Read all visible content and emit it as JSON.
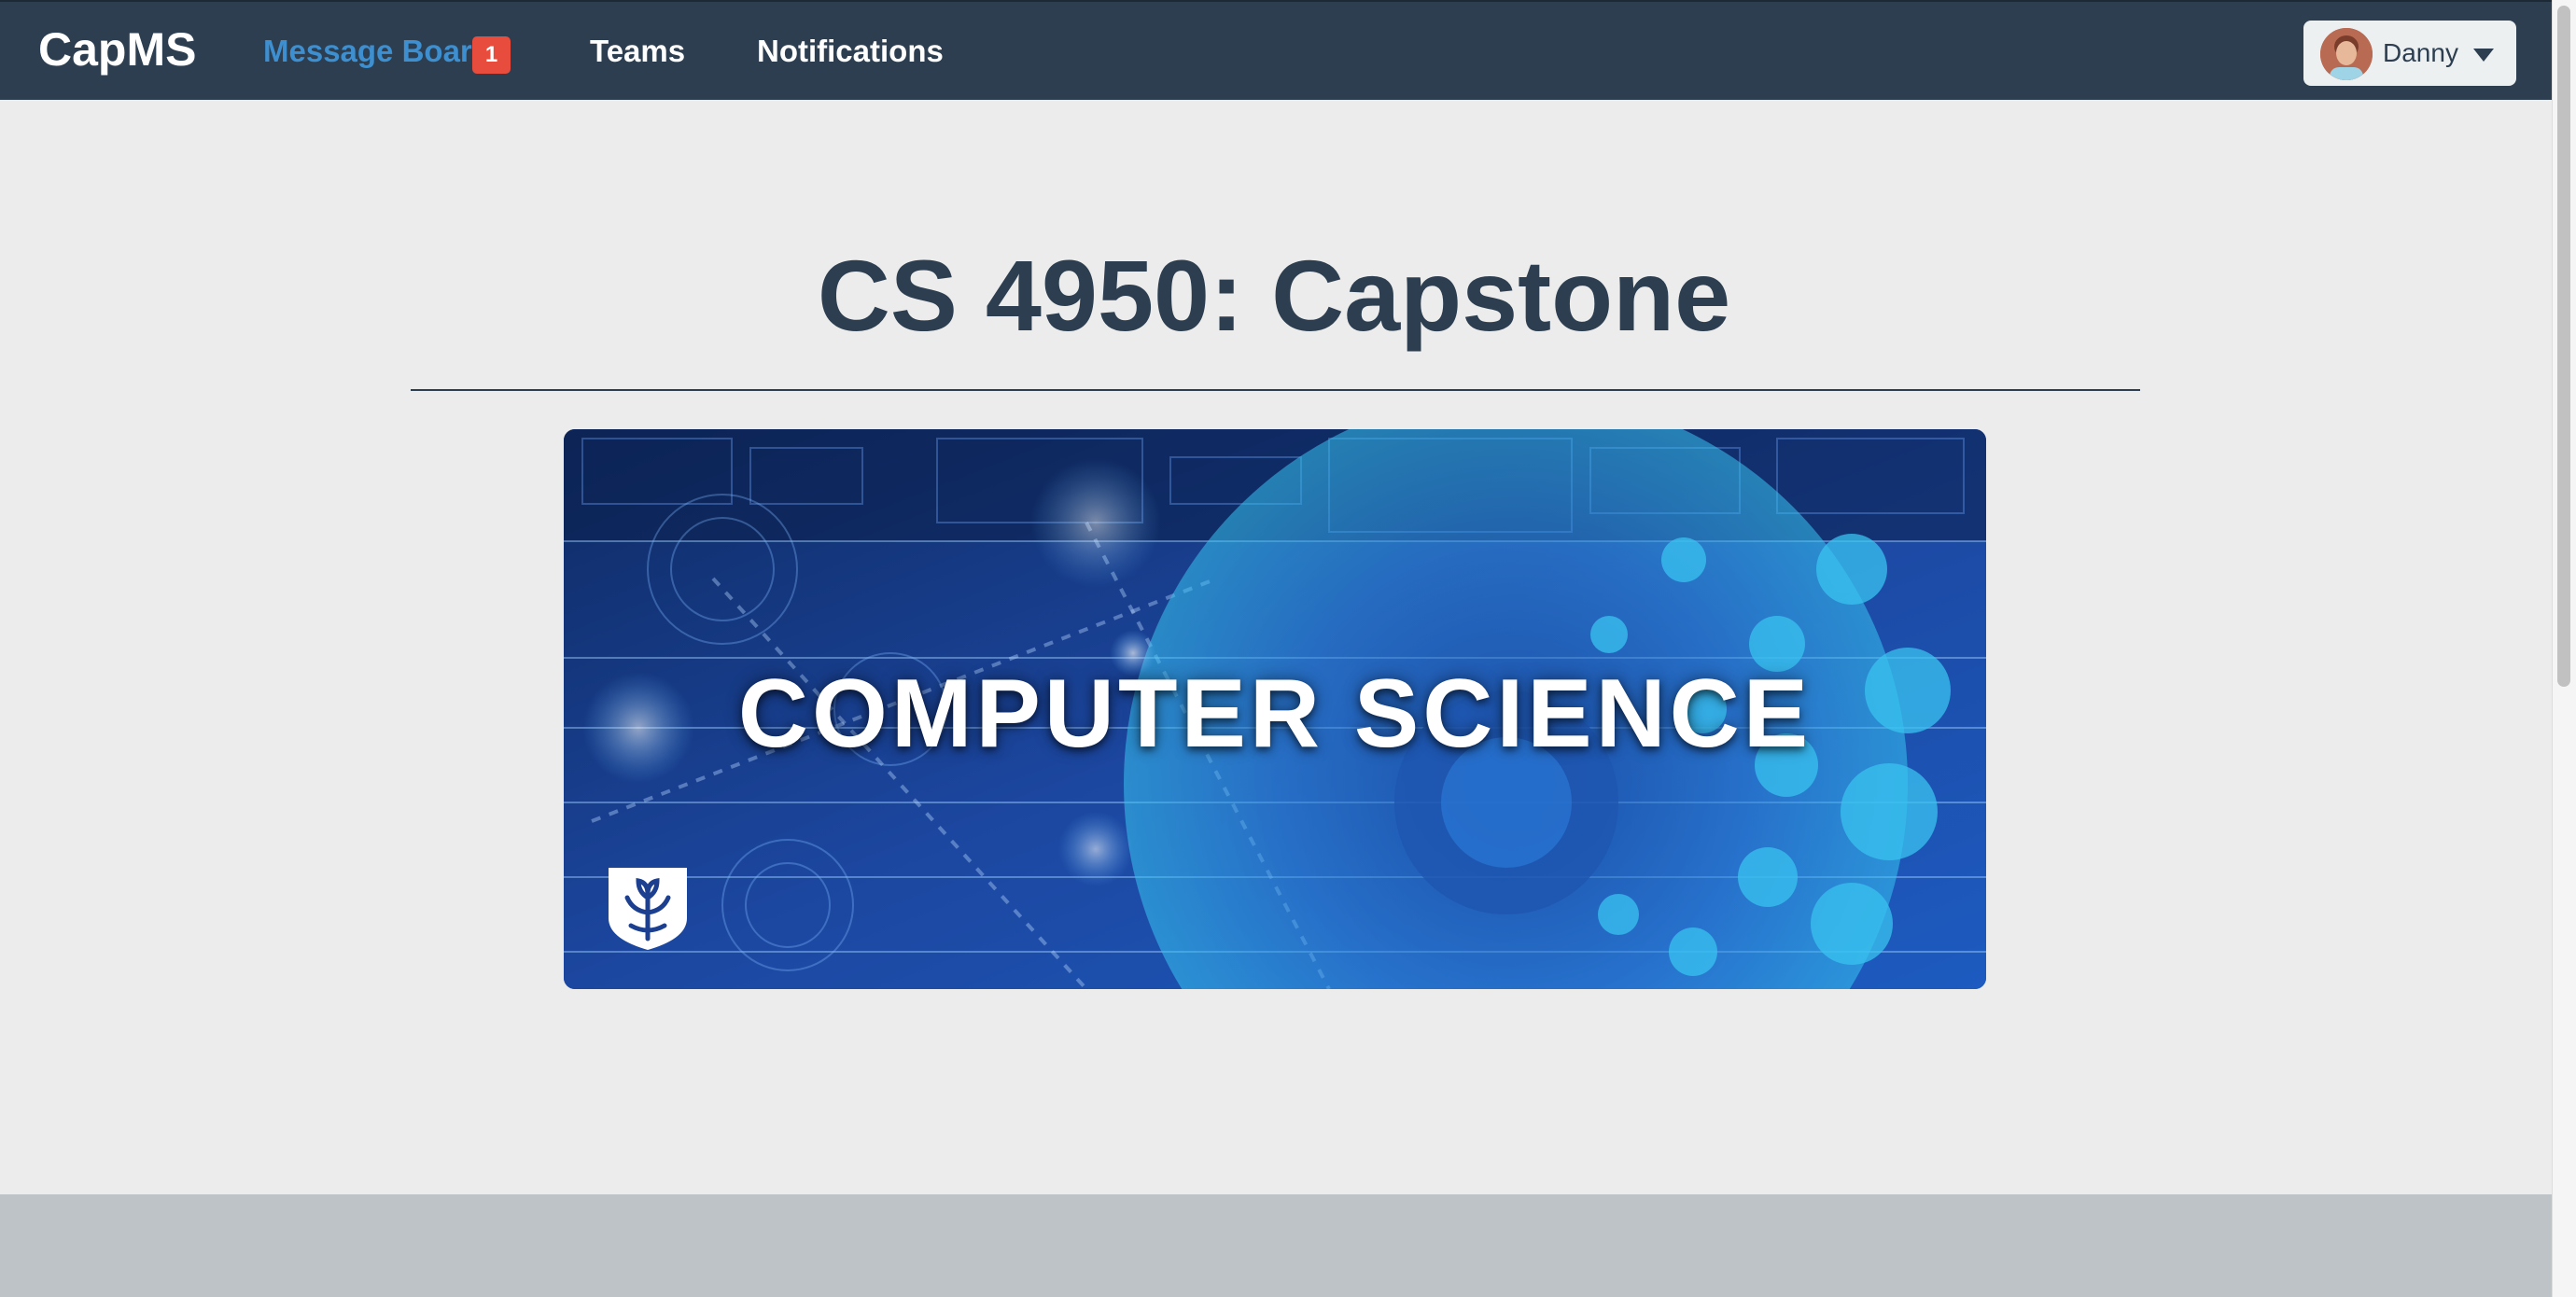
{
  "brand": "CapMS",
  "nav": {
    "message_board": "Message Board",
    "message_board_badge": "1",
    "teams": "Teams",
    "notifications": "Notifications"
  },
  "user": {
    "name": "Danny"
  },
  "main": {
    "title": "CS 4950: Capstone",
    "banner_text": "COMPUTER SCIENCE"
  },
  "colors": {
    "navbar": "#2c3e50",
    "active_link": "#3d8fd0",
    "badge": "#e74c3c",
    "page_bg": "#ececec",
    "footer": "#bdc3c7"
  },
  "icons": {
    "user_menu": "chevron-down-icon",
    "banner_logo": "shield-leaf-logo"
  }
}
